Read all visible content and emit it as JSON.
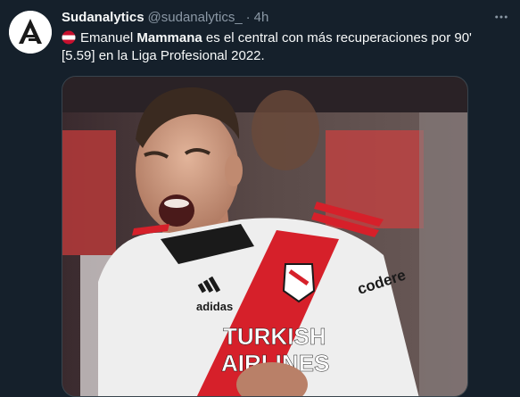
{
  "tweet": {
    "display_name": "Sudanalytics",
    "handle": "@sudanalytics_",
    "separator": "·",
    "time": "4h",
    "text_part1": "Emanuel ",
    "text_bold": "Mammana",
    "text_part2": " es el central con más recuperaciones por 90' [5.59] en la Liga Profesional 2022.",
    "avatar_icon": "sudanalytics-logo",
    "flag_icon": "argentina-flag-icon",
    "more_icon": "more-options-icon"
  },
  "media": {
    "jersey_sponsor_line1": "TURKISH",
    "jersey_sponsor_line2": "AIRLINES",
    "jersey_brand": "adidas",
    "sleeve_sponsor": "codere"
  },
  "colors": {
    "background": "#15202b",
    "text": "#f7f9f9",
    "secondary": "#8b98a5",
    "jersey_red": "#d6202a"
  }
}
